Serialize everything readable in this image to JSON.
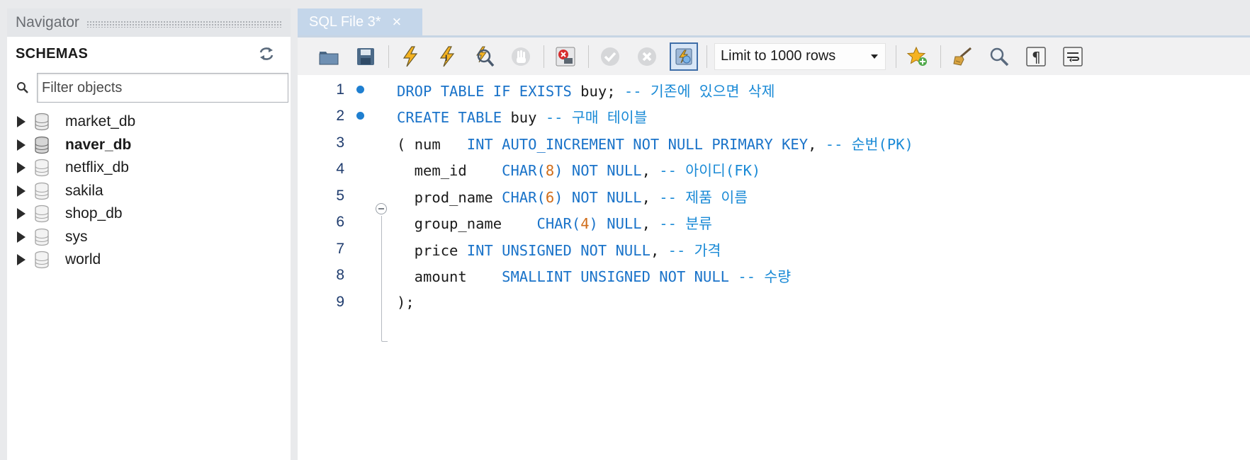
{
  "navigator": {
    "title": "Navigator",
    "schemas_label": "SCHEMAS",
    "filter_placeholder": "Filter objects",
    "schemas": [
      {
        "name": "market_db",
        "bold": false
      },
      {
        "name": "naver_db",
        "bold": true
      },
      {
        "name": "netflix_db",
        "bold": false
      },
      {
        "name": "sakila",
        "bold": false
      },
      {
        "name": "shop_db",
        "bold": false
      },
      {
        "name": "sys",
        "bold": false
      },
      {
        "name": "world",
        "bold": false
      }
    ]
  },
  "editor": {
    "tab_label": "SQL File 3*",
    "tab_close": "×",
    "limit_label": "Limit to 1000 rows",
    "line_numbers": [
      "1",
      "2",
      "3",
      "4",
      "5",
      "6",
      "7",
      "8",
      "9"
    ],
    "lines": {
      "l1": {
        "drop": "DROP TABLE IF EXISTS",
        "buy": " buy;",
        "comment": " -- 기존에 있으면 삭제"
      },
      "l2": {
        "create": "CREATE TABLE",
        "buy": " buy",
        "comment": " -- 구매 테이블"
      },
      "l3": {
        "open": "( ",
        "col": "num   ",
        "type": "INT AUTO_INCREMENT NOT NULL PRIMARY KEY",
        "comma": ",",
        "comment": " -- 순번(PK)"
      },
      "l4": {
        "col": "  mem_id    ",
        "type": "CHAR(",
        "n": "8",
        "close": ") NOT NULL",
        "comma": ",",
        "comment": " -- 아이디(FK)"
      },
      "l5": {
        "col": "  prod_name ",
        "type": "CHAR(",
        "n": "6",
        "close": ") NOT NULL",
        "comma": ",",
        "comment": " -- 제품 이름"
      },
      "l6": {
        "col": "  group_name    ",
        "type": "CHAR(",
        "n": "4",
        "close": ") NULL",
        "comma": ",",
        "comment": " -- 분류"
      },
      "l7": {
        "col": "  price ",
        "type": "INT UNSIGNED NOT NULL",
        "comma": ",",
        "comment": " -- 가격"
      },
      "l8": {
        "col": "  amount    ",
        "type": "SMALLINT UNSIGNED NOT NULL",
        "comment": " -- 수량"
      },
      "l9": {
        "close": ");"
      }
    }
  },
  "icons": {
    "toolbar": [
      "open-folder-icon",
      "save-icon",
      "execute-lightning-icon",
      "execute-current-lightning-icon",
      "explain-magnifier-icon",
      "stop-hand-icon",
      "toggle-error-icon",
      "commit-check-icon",
      "rollback-x-icon",
      "autocommit-toggle-icon",
      "limit-select",
      "add-snippet-star-icon",
      "beautify-brush-icon",
      "find-magnifier-icon",
      "invisible-chars-pilcrow-icon",
      "word-wrap-icon"
    ]
  }
}
